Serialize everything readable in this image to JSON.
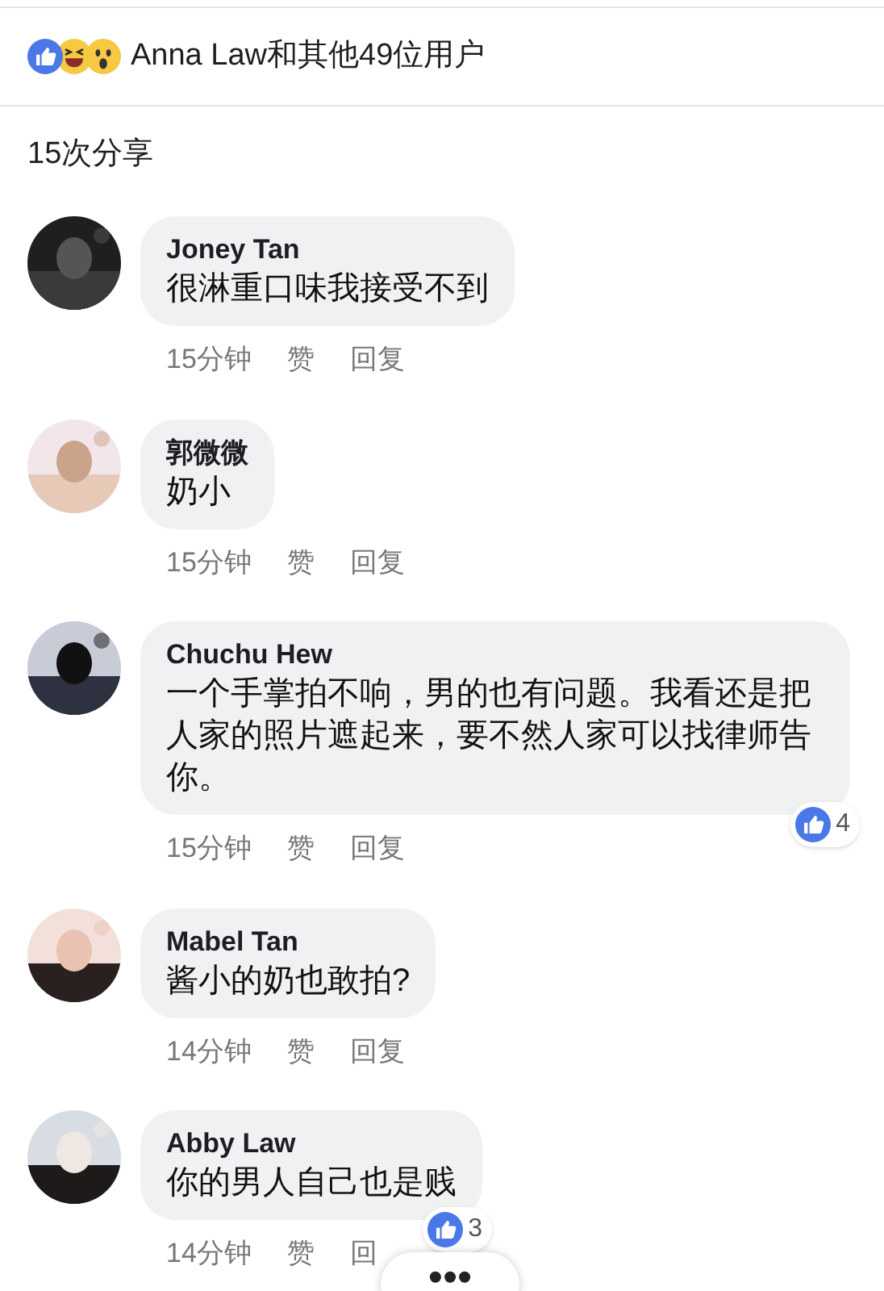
{
  "reactions_summary": {
    "text": "Anna Law和其他49位用户"
  },
  "shares": "15次分享",
  "comments": [
    {
      "author": "Joney Tan",
      "text": "很淋重口味我接受不到",
      "time": "15分钟",
      "like": "赞",
      "reply": "回复"
    },
    {
      "author": "郭微微",
      "text": "奶小",
      "time": "15分钟",
      "like": "赞",
      "reply": "回复"
    },
    {
      "author": "Chuchu Hew",
      "text": "一个手掌拍不响，男的也有问题。我看还是把人家的照片遮起来，要不然人家可以找律师告你。",
      "time": "15分钟",
      "like": "赞",
      "reply": "回复",
      "likes_count": "4"
    },
    {
      "author": "Mabel Tan",
      "text": "酱小的奶也敢拍?",
      "time": "14分钟",
      "like": "赞",
      "reply": "回复"
    },
    {
      "author": "Abby Law",
      "text": "你的男人自己也是贱",
      "time": "14分钟",
      "like": "赞",
      "reply": "回",
      "likes_count": "3"
    }
  ],
  "more_button": {
    "label": "•••"
  }
}
